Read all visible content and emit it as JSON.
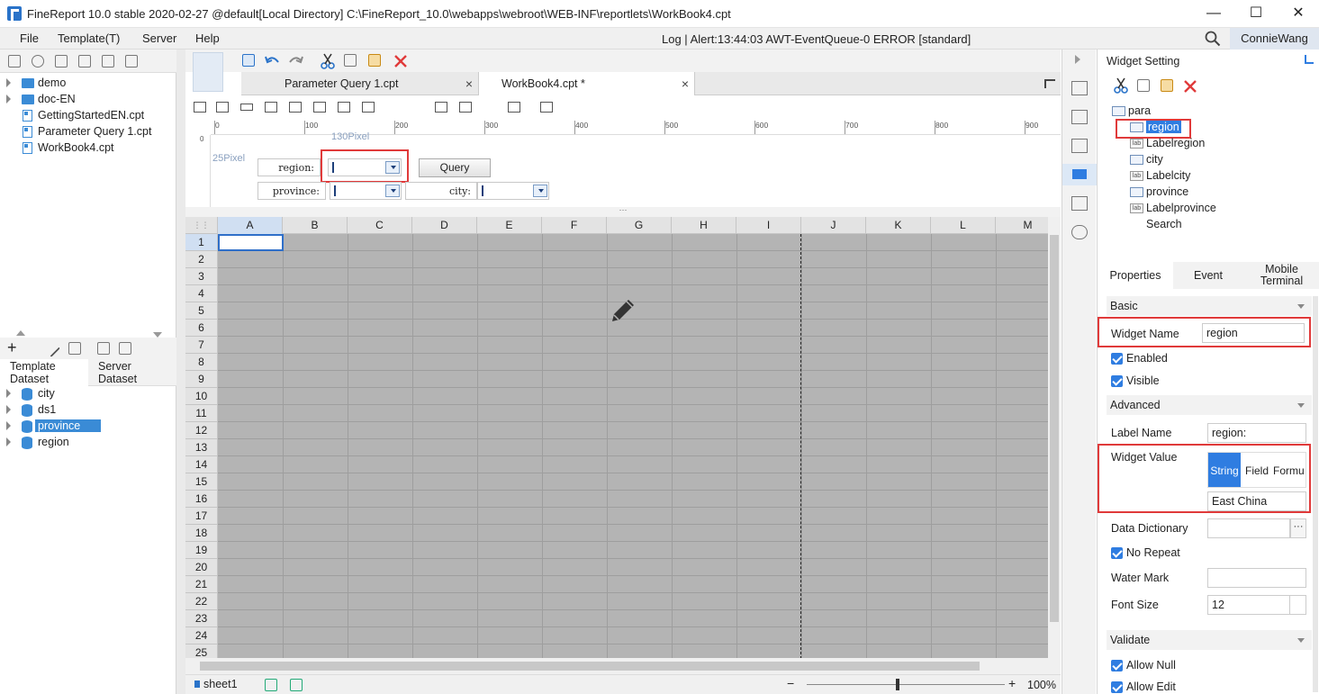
{
  "window": {
    "title": "FineReport 10.0 stable 2020-02-27 @default[Local Directory]     C:\\FineReport_10.0\\webapps\\webroot\\WEB-INF\\reportlets\\WorkBook4.cpt",
    "minimize": "—",
    "maximize": "☐",
    "close": "✕"
  },
  "menu": {
    "items": [
      "File",
      "Template(T)",
      "Server",
      "Help"
    ],
    "log": "Log | Alert:13:44:03 AWT-EventQueue-0 ERROR [standard]",
    "user": "ConnieWang"
  },
  "file_tree": [
    {
      "label": "demo",
      "type": "folder"
    },
    {
      "label": "doc-EN",
      "type": "folder"
    },
    {
      "label": "GettingStartedEN.cpt",
      "type": "file"
    },
    {
      "label": "Parameter Query 1.cpt",
      "type": "file"
    },
    {
      "label": "WorkBook4.cpt",
      "type": "file"
    }
  ],
  "dataset_tabs": {
    "template": "Template\nDataset",
    "server": "Server\nDataset"
  },
  "datasets": [
    "city",
    "ds1",
    "province",
    "region"
  ],
  "selected_dataset": "province",
  "editor_tabs": [
    {
      "label": "Parameter Query 1.cpt",
      "close": "×"
    },
    {
      "label": "WorkBook4.cpt *",
      "close": "×"
    }
  ],
  "ruler": {
    "ticks": [
      "0",
      "100",
      "200",
      "300",
      "400",
      "500",
      "600",
      "700",
      "800",
      "900"
    ],
    "width_hint": "130Pixel",
    "height_hint": "25Pixel",
    "v_zero": "0"
  },
  "params": {
    "region_label": "region:",
    "province_label": "province:",
    "city_label": "city:",
    "query_button": "Query"
  },
  "sheet": {
    "columns": [
      "A",
      "B",
      "C",
      "D",
      "E",
      "F",
      "G",
      "H",
      "I",
      "J",
      "K",
      "L",
      "M"
    ],
    "rows": [
      "1",
      "2",
      "3",
      "4",
      "5",
      "6",
      "7",
      "8",
      "9",
      "10",
      "11",
      "12",
      "13",
      "14",
      "15",
      "16",
      "17",
      "18",
      "19",
      "20",
      "21",
      "22",
      "23",
      "24",
      "25"
    ]
  },
  "status": {
    "sheet_name": "sheet1",
    "zoom": "100%",
    "minus": "−",
    "plus": "+"
  },
  "widget_setting": {
    "title": "Widget Setting",
    "tree_root": "para",
    "tree": [
      {
        "label": "region",
        "icon": "combo",
        "selected": true
      },
      {
        "label": "Labelregion",
        "icon": "lab"
      },
      {
        "label": "city",
        "icon": "combo"
      },
      {
        "label": "Labelcity",
        "icon": "lab"
      },
      {
        "label": "province",
        "icon": "combo"
      },
      {
        "label": "Labelprovince",
        "icon": "lab"
      },
      {
        "label": "Search",
        "icon": "none"
      }
    ],
    "tabs": [
      "Properties",
      "Event",
      "Mobile\nTerminal"
    ]
  },
  "properties": {
    "basic": "Basic",
    "widget_name_label": "Widget Name",
    "widget_name_value": "region",
    "enabled": "Enabled",
    "visible": "Visible",
    "advanced": "Advanced",
    "label_name_label": "Label Name",
    "label_name_value": "region:",
    "widget_value_label": "Widget Value",
    "value_types": [
      "String",
      "Field",
      "Formu"
    ],
    "widget_value": "East China",
    "data_dictionary": "Data Dictionary",
    "dict_button": "···",
    "no_repeat": "No Repeat",
    "water_mark": "Water Mark",
    "font_size_label": "Font Size",
    "font_size_value": "12",
    "validate": "Validate",
    "allow_null": "Allow Null",
    "allow_edit": "Allow Edit"
  },
  "colors": {
    "accent": "#2f7de1",
    "highlight": "#e03a3a",
    "grid": "#b4b4b4"
  }
}
